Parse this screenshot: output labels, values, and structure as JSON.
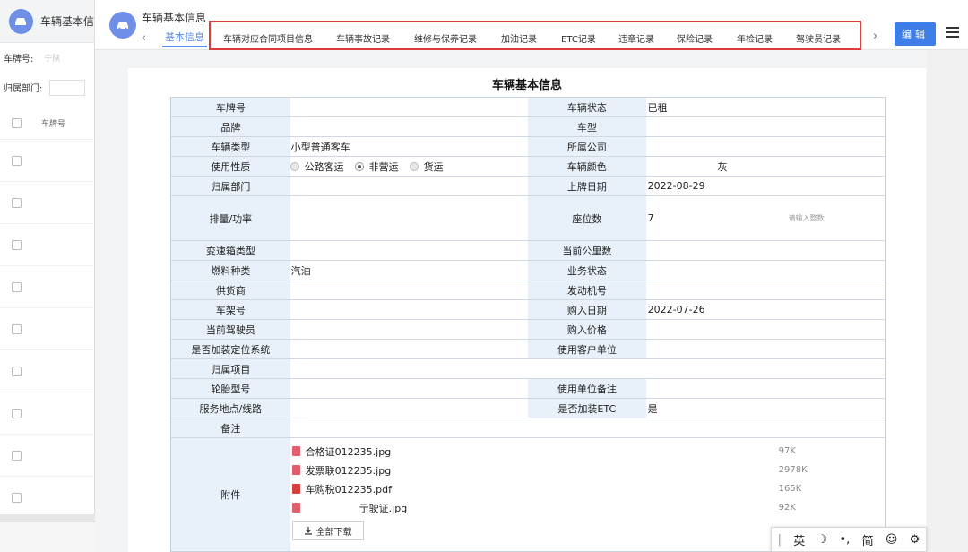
{
  "background_panel": {
    "title": "车辆基本信",
    "filter_plate_label": "车牌号:",
    "filter_plate_value": "宁陕",
    "filter_dept_label": "归属部门:",
    "column_plate": "车牌号"
  },
  "dialog": {
    "title": "车辆基本信息",
    "tab_basic": "基本信息",
    "tabs": [
      "车辆对应合同项目信息",
      "车辆事故记录",
      "维修与保养记录",
      "加油记录",
      "ETC记录",
      "违章记录",
      "保险记录",
      "年检记录",
      "驾驶员记录"
    ],
    "edit_label": "编辑"
  },
  "sheet": {
    "title": "车辆基本信息",
    "rows": [
      {
        "l1": "车牌号",
        "v1": "",
        "l2": "车辆状态",
        "v2": "已租"
      },
      {
        "l1": "品牌",
        "v1": "",
        "l2": "车型",
        "v2": ""
      },
      {
        "l1": "车辆类型",
        "v1": "小型普通客车",
        "l2": "所属公司",
        "v2": ""
      },
      {
        "l1": "使用性质",
        "v1": "",
        "l2": "车辆颜色",
        "v2": "灰"
      },
      {
        "l1": "归属部门",
        "v1": "",
        "l2": "上牌日期",
        "v2": "2022-08-29"
      },
      {
        "l1": "排量/功率",
        "v1": "",
        "l2": "座位数",
        "v2": "7"
      },
      {
        "l1": "变速箱类型",
        "v1": "",
        "l2": "当前公里数",
        "v2": ""
      },
      {
        "l1": "燃料种类",
        "v1": "汽油",
        "l2": "业务状态",
        "v2": ""
      },
      {
        "l1": "供货商",
        "v1": "",
        "l2": "发动机号",
        "v2": ""
      },
      {
        "l1": "车架号",
        "v1": "",
        "l2": "购入日期",
        "v2": "2022-07-26"
      },
      {
        "l1": "当前驾驶员",
        "v1": "",
        "l2": "购入价格",
        "v2": ""
      },
      {
        "l1": "是否加装定位系统",
        "v1": "",
        "l2": "使用客户单位",
        "v2": ""
      },
      {
        "l1": "归属项目",
        "v1": "",
        "l2": "",
        "v2": ""
      },
      {
        "l1": "轮胎型号",
        "v1": "",
        "l2": "使用单位备注",
        "v2": ""
      },
      {
        "l1": "服务地点/线路",
        "v1": "",
        "l2": "是否加装ETC",
        "v2": "是"
      }
    ],
    "usage_options": [
      "公路客运",
      "非营运",
      "货运"
    ],
    "usage_selected": "非营运",
    "seat_hint": "请输入整数",
    "remark_label": "备注",
    "attach_label": "附件",
    "files": [
      {
        "name": "合格证012235.jpg",
        "size": "97K",
        "type": "jpg"
      },
      {
        "name": "发票联012235.jpg",
        "size": "2978K",
        "type": "jpg"
      },
      {
        "name": "车购税012235.pdf",
        "size": "165K",
        "type": "pdf"
      },
      {
        "name": "亍驶证.jpg",
        "size": "92K",
        "type": "jpg"
      }
    ],
    "download_all": "全部下载"
  },
  "ime_bar": {
    "lang": "英",
    "punct": "•,",
    "mode": "简"
  },
  "colors": {
    "accent": "#3d7ee8",
    "tab_highlight": "#e03b3b",
    "label_bg": "#e8f1fa"
  }
}
